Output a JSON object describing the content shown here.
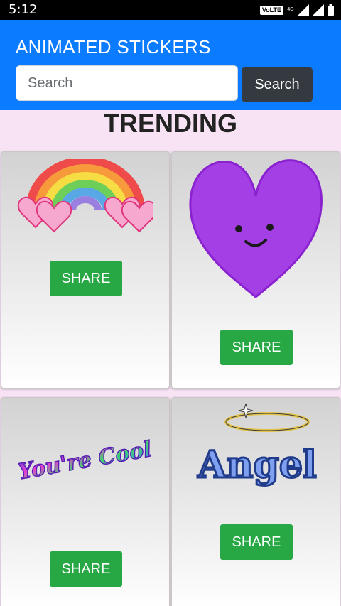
{
  "status_bar": {
    "time": "5:12",
    "volte": "VoLTE",
    "network": "4G",
    "icons": [
      "volte-icon",
      "signal-icon",
      "signal-icon",
      "battery-icon"
    ]
  },
  "header": {
    "title": "ANIMATED STICKERS",
    "search_placeholder": "Search",
    "search_value": "",
    "search_button": "Search"
  },
  "section": {
    "title": "TRENDING"
  },
  "stickers": [
    {
      "name": "rainbow-hearts",
      "share": "SHARE"
    },
    {
      "name": "purple-heart",
      "share": "SHARE"
    },
    {
      "name": "youre-cool",
      "text": "You're Cool",
      "share": "SHARE"
    },
    {
      "name": "angel",
      "text": "Angel",
      "share": "SHARE"
    }
  ],
  "colors": {
    "appbar": "#0b7bff",
    "share_button": "#28a745",
    "search_button": "#343a40",
    "page_background": "#f7e3f4"
  }
}
